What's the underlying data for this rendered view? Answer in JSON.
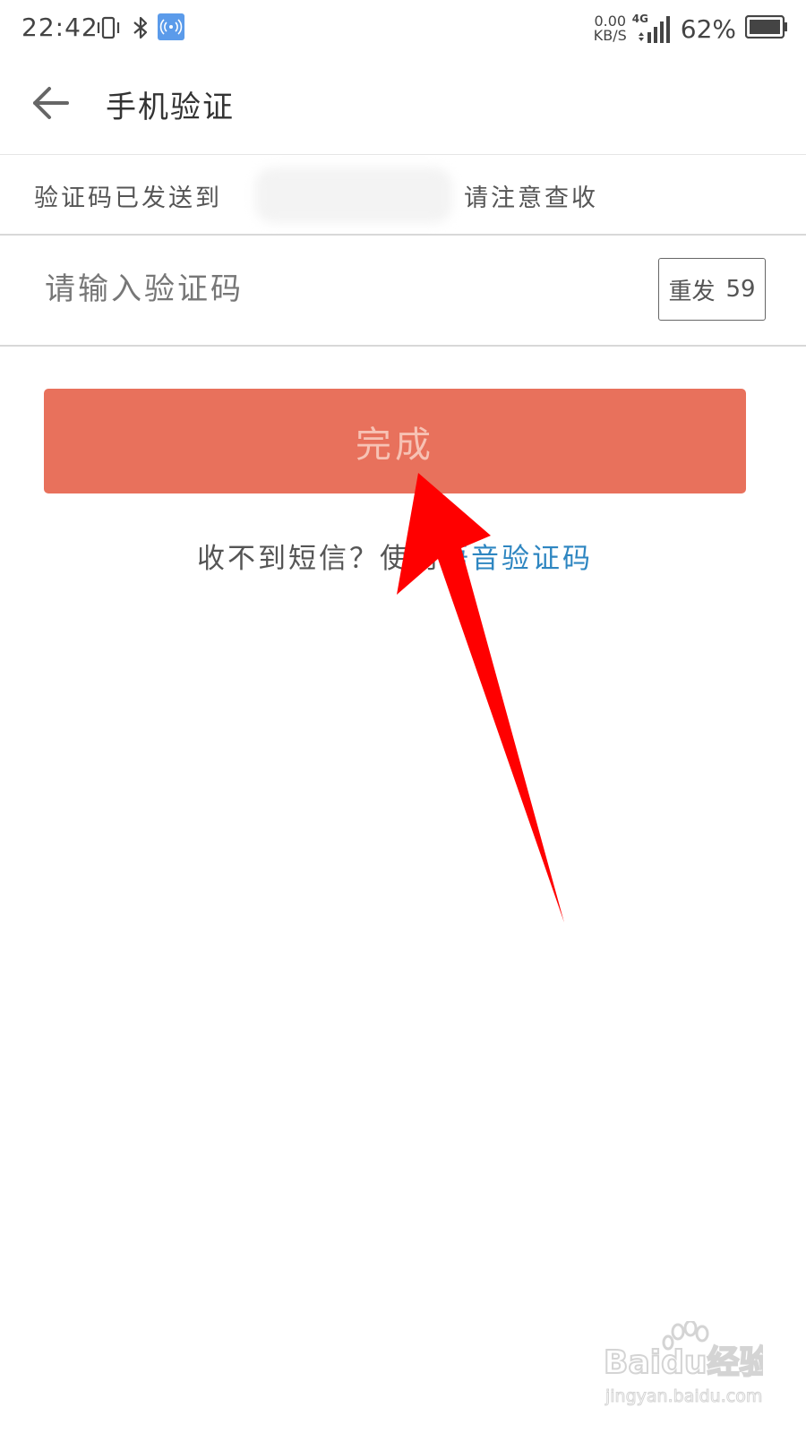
{
  "status_bar": {
    "time": "22:42",
    "net_speed_value": "0.00",
    "net_speed_unit": "KB/S",
    "network_type": "4G",
    "battery_percent": "62%",
    "hotspot_color": "#5b9bea"
  },
  "header": {
    "title": "手机验证"
  },
  "info": {
    "prefix": "验证码已发送到",
    "suffix": "请注意查收"
  },
  "code_input": {
    "placeholder": "请输入验证码",
    "value": ""
  },
  "resend": {
    "label": "重发",
    "countdown": "59"
  },
  "done_button": {
    "label": "完成",
    "color": "#e8715c"
  },
  "hint": {
    "text": "收不到短信？使用",
    "link": "语音验证码"
  },
  "annotation": {
    "arrow_color": "#ff0000"
  },
  "watermark": {
    "logo_text": "Baidu经验",
    "url": "jingyan.baidu.com"
  }
}
